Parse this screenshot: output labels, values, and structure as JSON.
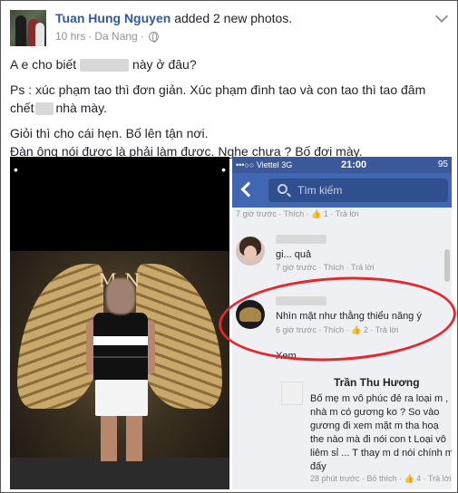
{
  "header": {
    "author": "Tuan Hung Nguyen",
    "action": "added 2 new photos.",
    "time": "10 hrs",
    "separator": "·",
    "location": "Da Nang",
    "separator2": "·"
  },
  "post": {
    "line1_a": "A e cho biết",
    "line1_b": "này ở đâu?",
    "line2": "Ps : xúc phạm tao thì đơn giản. Xúc phạm đình tao và con tao thì tao đâm",
    "line3_a": "chết",
    "line3_b": "nhà mày.",
    "line4": "Giỏi thì cho cái hẹn. Bố lên tận nơi.",
    "line5": "Đàn ông nói được là phải làm được. Nghe chưa ? Bố đợi mày."
  },
  "photo_left": {
    "dots_left": "•",
    "dots_right": "•",
    "sign": "M  N"
  },
  "photo_right": {
    "status": {
      "carrier": "•••○○ Viettel",
      "network": "3G",
      "time": "21:00",
      "battery": "95"
    },
    "search_placeholder": "Tìm kiếm",
    "comment1_meta": "7 giờ trước · Thích · 👍 1 · Trả lời",
    "comment2_text": "gi...                   quả",
    "comment2_meta": "7 giờ trước · Thích · Trả lời",
    "comment3_text": "Nhìn mặt như thằng thiểu năng ý",
    "comment3_meta": "6 giờ trước · Thích · 👍 2 · Trả lời",
    "xem": "Xem",
    "comment4_name": "Trần Thu Hương",
    "comment4_text": "Bố mẹ m vô phúc đẻ ra loại m , nhà m có gương ko ? So vào gương đi xem mặt m tha hoạ the nào mà đi nói con t Loại vô liêm sỉ ... T thay m d nói chính m đấy",
    "comment4_meta": "28 phút trước · Bỏ thích · 👍 4 · Trả lời"
  }
}
